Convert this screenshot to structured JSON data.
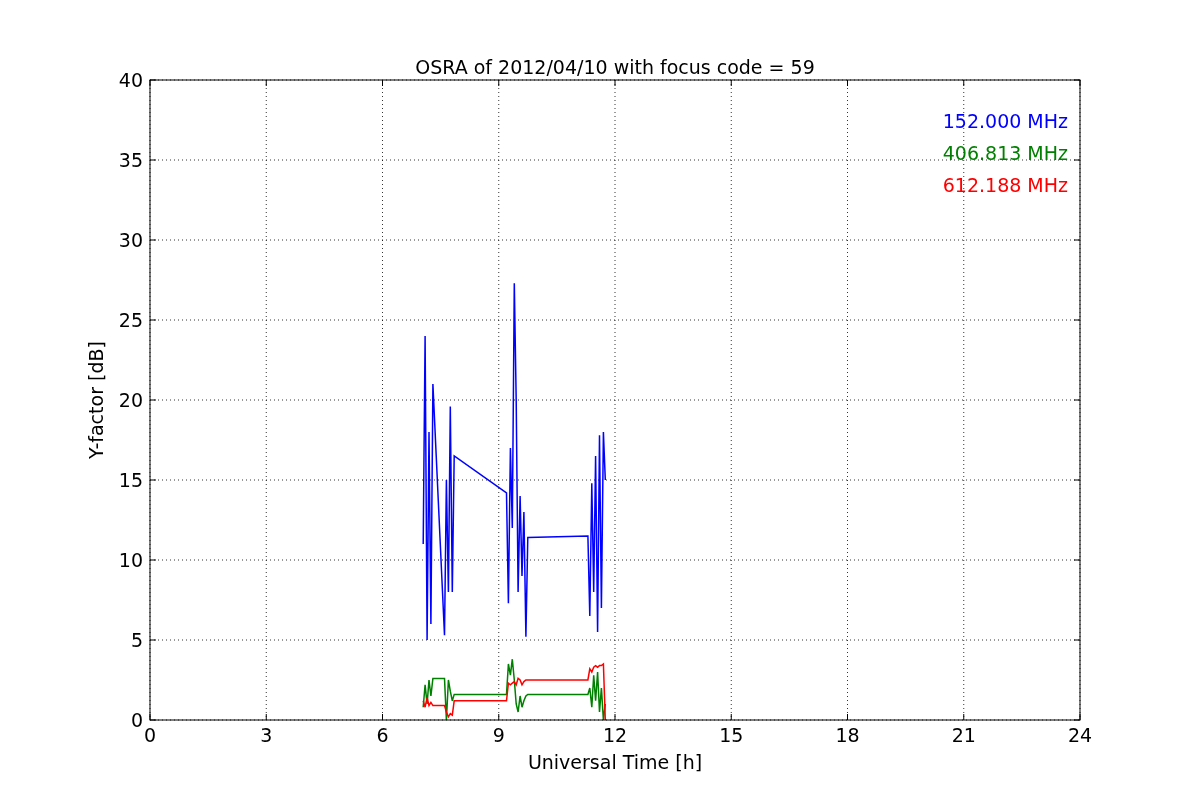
{
  "figure": {
    "chart_data": {
      "type": "line",
      "title": "OSRA of 2012/04/10 with focus code = 59",
      "xlabel": "Universal Time [h]",
      "ylabel": "Y-factor [dB]",
      "x": [
        7.05,
        7.1,
        7.15,
        7.2,
        7.25,
        7.3,
        7.6,
        7.65,
        7.7,
        7.75,
        7.8,
        7.85,
        9.2,
        9.25,
        9.3,
        9.35,
        9.4,
        9.45,
        9.5,
        9.55,
        9.6,
        9.65,
        9.7,
        9.75,
        11.3,
        11.35,
        11.4,
        11.45,
        11.5,
        11.55,
        11.6,
        11.65,
        11.7,
        11.75
      ],
      "series": [
        {
          "name": "152.000 MHz",
          "color": "#0000ff",
          "values": [
            11,
            24,
            5,
            18,
            6,
            21,
            5.3,
            15,
            8,
            19.6,
            8,
            16.5,
            14.2,
            7.3,
            17,
            12,
            27.3,
            20,
            8,
            14,
            9,
            13,
            5.2,
            11.4,
            11.5,
            6.5,
            14.8,
            8,
            16.5,
            5.5,
            17.8,
            7,
            18,
            15
          ]
        },
        {
          "name": "406.813 MHz",
          "color": "#008000",
          "values": [
            0.8,
            2.2,
            1,
            2.5,
            1.5,
            2.6,
            2.6,
            0,
            2.5,
            1.8,
            1.2,
            1.6,
            1.6,
            3.5,
            2.8,
            3.8,
            2.5,
            1,
            0.5,
            1.5,
            0.8,
            1.2,
            1.5,
            1.6,
            1.6,
            2,
            0.8,
            2.8,
            1.2,
            3,
            0.5,
            2,
            0,
            1
          ]
        },
        {
          "name": "612.188 MHz",
          "color": "#ff0000",
          "values": [
            1.2,
            0.8,
            1.4,
            0.9,
            1.1,
            0.9,
            0.9,
            0.5,
            0.2,
            0.4,
            0.3,
            1.2,
            1.2,
            2.3,
            2.2,
            2.3,
            2.4,
            2.2,
            2.6,
            2.5,
            2.2,
            2.4,
            2.5,
            2.5,
            2.5,
            3.2,
            3,
            3.3,
            3.4,
            3.3,
            3.4,
            3.4,
            3.5,
            0
          ]
        }
      ],
      "grid": true,
      "xlim": [
        0,
        24
      ],
      "ylim": [
        0,
        40
      ],
      "xticks": [
        0,
        3,
        6,
        9,
        12,
        15,
        18,
        21,
        24
      ],
      "yticks": [
        0,
        5,
        10,
        15,
        20,
        25,
        30,
        35,
        40
      ]
    }
  }
}
